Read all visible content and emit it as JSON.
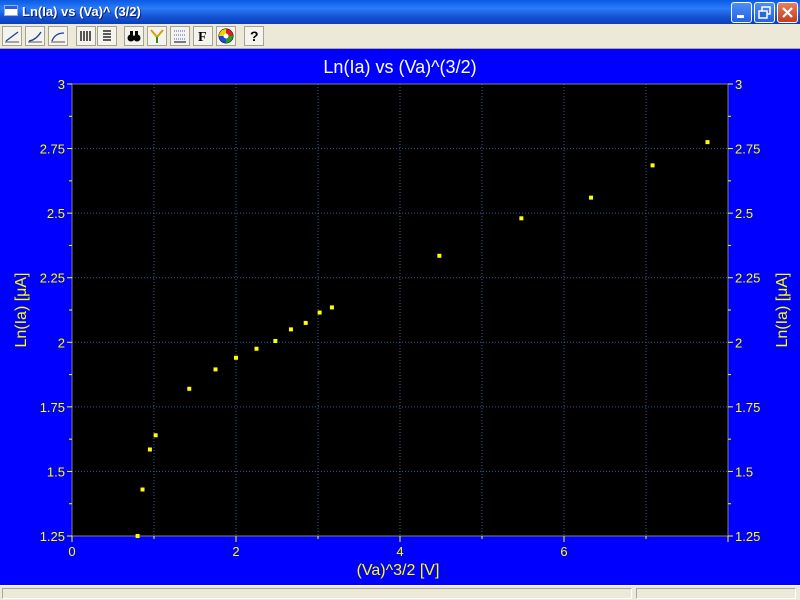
{
  "window": {
    "title": "Ln(Ia) vs (Va)^ (3/2)",
    "buttons": [
      "minimize",
      "restore",
      "close"
    ]
  },
  "toolbar": {
    "items": [
      {
        "icon": "line-chart-icon"
      },
      {
        "icon": "curve-chart-icon"
      },
      {
        "icon": "smooth-chart-icon"
      },
      {
        "icon": "bar-chart-icon"
      },
      {
        "icon": "list-icon"
      },
      {
        "icon": "binoculars-icon",
        "glyph": "◎"
      },
      {
        "icon": "filter-icon",
        "glyph": "Y"
      },
      {
        "icon": "grid-settings-icon"
      },
      {
        "icon": "font-icon",
        "glyph": "F"
      },
      {
        "icon": "color-palette-icon"
      },
      {
        "icon": "help-icon",
        "glyph": "?"
      }
    ]
  },
  "colors": {
    "background": "#0000ff",
    "plot_area": "#000000",
    "grid": "#2f5f8f",
    "text": "#ffff00",
    "marker": "#ffff00",
    "title_text": "#ffffff"
  },
  "chart_data": {
    "type": "scatter",
    "title": "Ln(Ia) vs (Va)^(3/2)",
    "xlabel": "(Va)^3/2 [V]",
    "ylabel": "Ln(Ia) [μA]",
    "ylabel_right": "Ln(Ia) [μA]",
    "xlim": [
      0,
      8
    ],
    "ylim": [
      1.25,
      3
    ],
    "x_ticks": [
      "0",
      "2",
      "4",
      "6"
    ],
    "y_ticks": [
      "1.25",
      "1.5",
      "1.75",
      "2",
      "2.25",
      "2.5",
      "2.75",
      "3"
    ],
    "grid": true,
    "series": [
      {
        "x": [
          0.8,
          0.86,
          0.95,
          1.02,
          1.43,
          1.75,
          2.0,
          2.25,
          2.48,
          2.67,
          2.85,
          3.02,
          3.17,
          4.48,
          5.48,
          6.33,
          7.08,
          7.75
        ],
        "y": [
          1.25,
          1.43,
          1.585,
          1.64,
          1.82,
          1.895,
          1.94,
          1.975,
          2.005,
          2.05,
          2.075,
          2.115,
          2.135,
          2.335,
          2.48,
          2.56,
          2.685,
          2.775
        ]
      }
    ]
  }
}
